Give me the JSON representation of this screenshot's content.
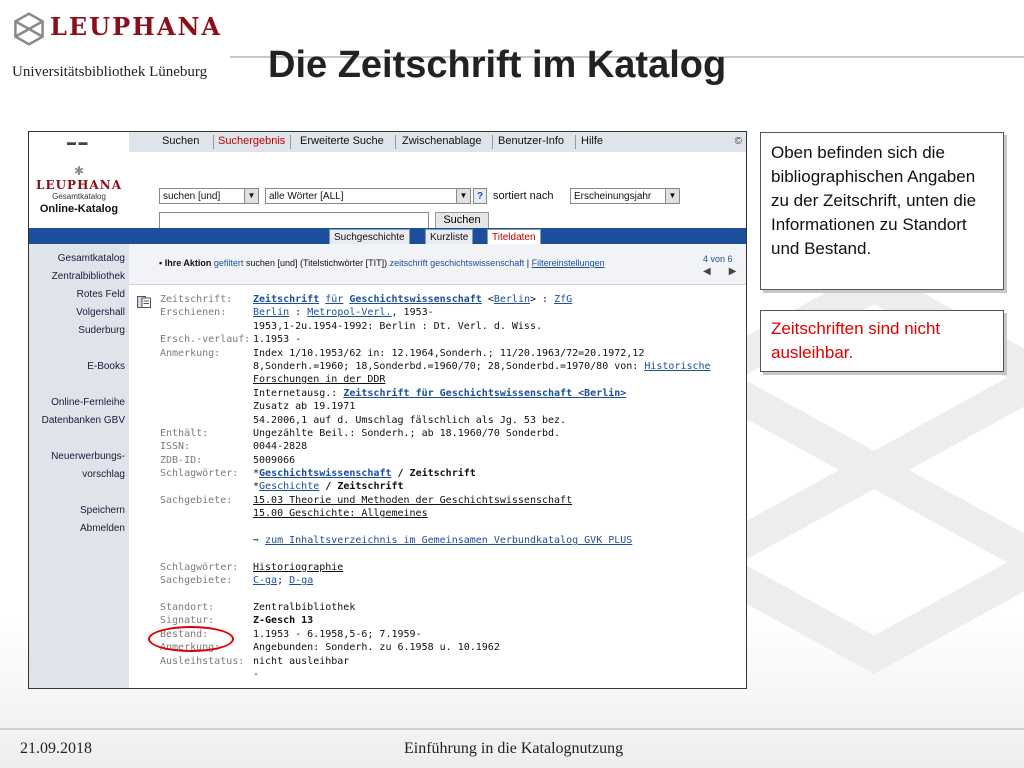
{
  "header": {
    "logo_text": "LEUPHANA",
    "university": "Universitätsbibliothek Lüneburg",
    "title": "Die Zeitschrift im Katalog"
  },
  "catalog": {
    "logo": {
      "brand": "LEUPHANA",
      "sub": "Gesamtkatalog",
      "name": "Online-Katalog"
    },
    "tabs": [
      "Suchen",
      "Suchergebnis",
      "Erweiterte Suche",
      "Zwischenablage",
      "Benutzer-Info",
      "Hilfe"
    ],
    "search": {
      "op": "suchen [und]",
      "field": "alle Wörter [ALL]",
      "help": "?",
      "sort_label": "sortiert nach",
      "sort": "Erscheinungsjahr",
      "button": "Suchen"
    },
    "subtabs": [
      "Suchgeschichte",
      "Kurzliste",
      "Titeldaten"
    ],
    "sidebar": [
      "Gesamtkatalog",
      "Zentralbibliothek",
      "Rotes Feld",
      "Volgershall",
      "Suderburg",
      "",
      "E-Books",
      "",
      "Online-Fernleihe",
      "Datenbanken GBV",
      "",
      "Neuerwerbungs-",
      "vorschlag",
      "",
      "Speichern",
      "Abmelden"
    ],
    "action": {
      "label": "Ihre Aktion",
      "p1": "gefiltert",
      "p2": "suchen [und] (Titelstichwörter [TIT])",
      "p3": "zeitschrift geschichtswissenschaft",
      "filter": "Filtereinstellungen",
      "page": "4 von 6",
      "prev": "◀",
      "next": "▶"
    },
    "record": {
      "l_zs": "Zeitschrift:",
      "zs_a": "Zeitschrift",
      "zs_b": "für",
      "zs_c": "Geschichtswissenschaft",
      "zs_d": "<",
      "zs_e": "Berlin",
      "zs_f": "> :",
      "zs_g": "ZfG",
      "l_ersch": "Erschienen:",
      "e1a": "Berlin",
      "e1b": ":",
      "e1c": "Metropol-Verl.",
      "e1d": ", 1953-",
      "e2": "1953,1-2u.1954-1992: Berlin : Dt. Verl. d. Wiss.",
      "l_verlauf": "Ersch.-verlauf:",
      "verlauf": "1.1953 -",
      "l_anm": "Anmerkung:",
      "a1": "Index 1/10.1953/62 in: 12.1964,Sonderh.; 11/20.1963/72=20.1972,12",
      "a2a": "8,Sonderh.=1960; 18,Sonderbd.=1960/70; 28,Sonderbd.=1970/80 von:",
      "a2b": "Historische",
      "a3": "Forschungen in der DDR",
      "a4a": "Internetausg.:",
      "a4b": "Zeitschrift für Geschichtswissenschaft <Berlin>",
      "a5": "Zusatz ab 19.1971",
      "a6": "54.2006,1 auf d. Umschlag fälschlich als Jg. 53 bez.",
      "l_enth": "Enthält:",
      "enth": "Ungezählte Beil.: Sonderh.; ab 18.1960/70 Sonderbd.",
      "l_issn": "ISSN:",
      "issn": "0044-2828",
      "l_zdb": "ZDB-ID:",
      "zdb": "5009066",
      "l_schlag": "Schlagwörter:",
      "s1a": "*",
      "s1b": "Geschichtswissenschaft",
      "s1c": "/ Zeitschrift",
      "s2a": "*",
      "s2b": "Geschichte",
      "s2c": "/ Zeitschrift",
      "l_sachg": "Sachgebiete:",
      "g1": "15.03 Theorie und Methoden der Geschichtswissenschaft",
      "g2": "15.00 Geschichte: Allgemeines",
      "gvk_arrow": "➡",
      "gvk": "zum Inhaltsverzeichnis im Gemeinsamen Verbundkatalog GVK PLUS",
      "l_schlag2": "Schlagwörter:",
      "schlag2": "Historiographie",
      "l_sachg2": "Sachgebiete:",
      "sg2a": "C-ga",
      "sg2b": ";",
      "sg2c": "D-ga",
      "l_standort": "Standort:",
      "standort": "Zentralbibliothek",
      "l_signatur": "Signatur:",
      "signatur": "Z-Gesch 13",
      "l_bestand": "Bestand:",
      "bestand": "1.1953 - 6.1958,5-6; 7.1959-",
      "l_anm2": "Anmerkung:",
      "anm2": "Angebunden: Sonderh. zu 6.1958 u. 10.1962",
      "l_ausleih": "Ausleihstatus:",
      "ausleih": "nicht ausleihbar",
      "dash": "-"
    }
  },
  "notes": {
    "n1": "Oben befinden sich die bibliographischen Angaben zu der Zeitschrift, unten die Informationen zu Standort und Bestand.",
    "n2": "Zeitschriften sind nicht ausleihbar."
  },
  "footer": {
    "date": "21.09.2018",
    "title": "Einführung in die Katalognutzung"
  },
  "colors": {
    "brand": "#8b0f1a",
    "link": "#1b4f9c",
    "highlight": "#e00000"
  }
}
